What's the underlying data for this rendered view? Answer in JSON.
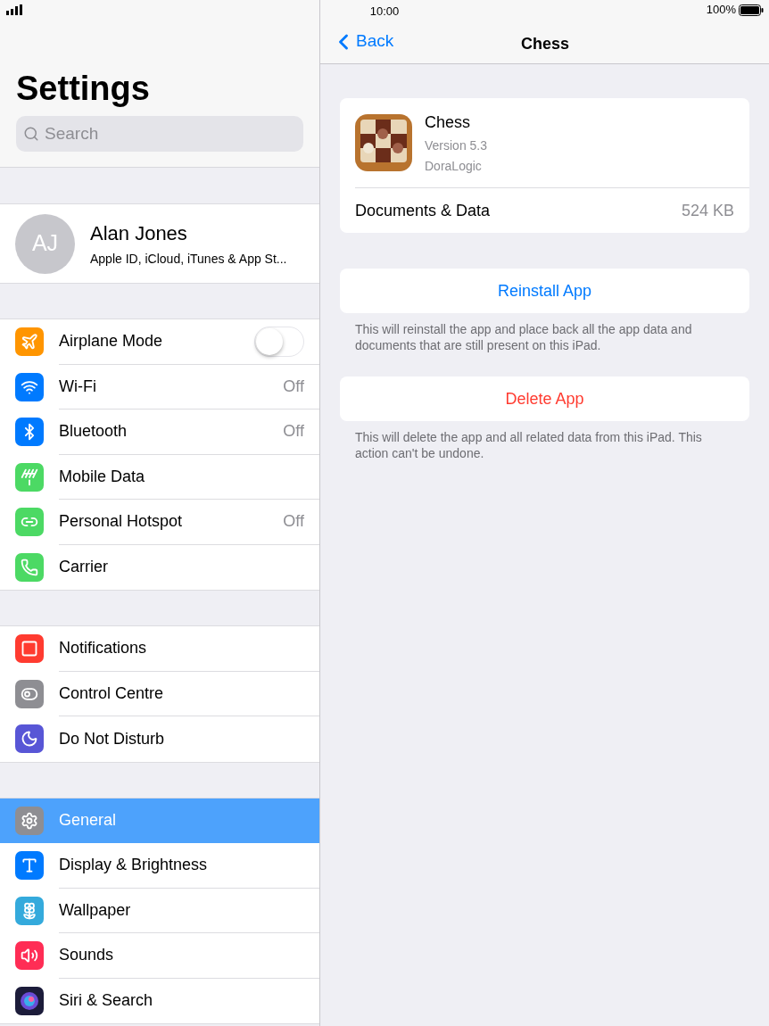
{
  "status_bar": {
    "time": "10:00",
    "battery": "100%"
  },
  "sidebar": {
    "title": "Settings",
    "search": {
      "placeholder": "Search"
    },
    "profile": {
      "initials": "AJ",
      "name": "Alan Jones",
      "subtitle": "Apple ID, iCloud, iTunes & App St..."
    },
    "groups": [
      [
        {
          "label": "Airplane Mode",
          "kind": "toggle",
          "on": false,
          "selected": false,
          "color": "#ff9500"
        },
        {
          "label": "Wi-Fi",
          "kind": "detail",
          "value": "Off",
          "selected": false,
          "color": "#007aff"
        },
        {
          "label": "Bluetooth",
          "kind": "detail",
          "value": "Off",
          "selected": false,
          "color": "#007aff"
        },
        {
          "label": "Mobile Data",
          "kind": "detail",
          "selected": false,
          "color": "#4cd964"
        },
        {
          "label": "Personal Hotspot",
          "kind": "detail",
          "value": "Off",
          "selected": false,
          "color": "#4cd964"
        },
        {
          "label": "Carrier",
          "kind": "detail",
          "selected": false,
          "color": "#4cd964"
        }
      ],
      [
        {
          "label": "Notifications",
          "kind": "detail",
          "selected": false,
          "color": "#ff3b30"
        },
        {
          "label": "Control Centre",
          "kind": "detail",
          "selected": false,
          "color": "#8e8e93"
        },
        {
          "label": "Do Not Disturb",
          "kind": "detail",
          "selected": false,
          "color": "#5856d6"
        }
      ],
      [
        {
          "label": "General",
          "kind": "detail",
          "selected": true,
          "color": "#8e8e93"
        },
        {
          "label": "Display & Brightness",
          "kind": "detail",
          "selected": false,
          "color": "#007aff"
        },
        {
          "label": "Wallpaper",
          "kind": "detail",
          "selected": false,
          "color": "#34aadc"
        },
        {
          "label": "Sounds",
          "kind": "detail",
          "selected": false,
          "color": "#ff2d55"
        },
        {
          "label": "Siri & Search",
          "kind": "detail",
          "selected": false,
          "color": "#1c1c3a"
        }
      ]
    ]
  },
  "detail": {
    "back": "Back",
    "title": "Chess",
    "app": {
      "name": "Chess",
      "version": "Version 5.3",
      "developer": "DoraLogic"
    },
    "usage": {
      "label": "Documents & Data",
      "value": "524 KB"
    },
    "actions": [
      {
        "label": "Reinstall App",
        "kind": "normal",
        "note": "This will reinstall the app and place back all the app data and documents that are still present on this iPad."
      },
      {
        "label": "Delete App",
        "kind": "destructive",
        "note": "This will delete the app and all related data from this iPad. This action can't be undone."
      }
    ]
  }
}
